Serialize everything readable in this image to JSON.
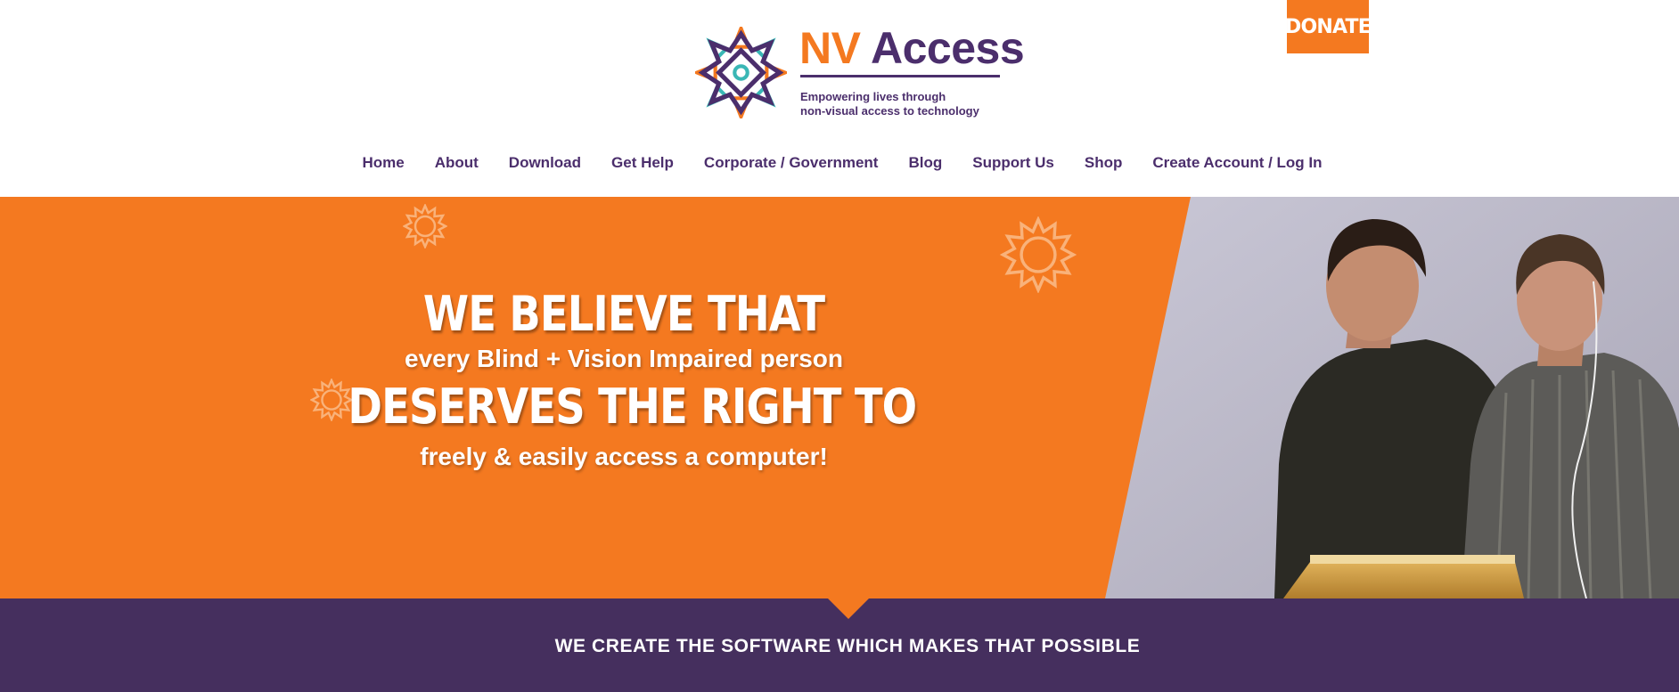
{
  "brand": {
    "name_part1": "NV",
    "name_part2": "Access",
    "tagline_line1": "Empowering lives through",
    "tagline_line2": "non-visual access to technology",
    "orange": "#f47920",
    "purple": "#4b2e6c",
    "teal": "#3ab7b5",
    "logo_icon": "sunburst-logo-icon"
  },
  "header": {
    "donate_label": "DONATE"
  },
  "nav": {
    "items": [
      {
        "label": "Home"
      },
      {
        "label": "About"
      },
      {
        "label": "Download"
      },
      {
        "label": "Get Help"
      },
      {
        "label": "Corporate / Government"
      },
      {
        "label": "Blog"
      },
      {
        "label": "Support Us"
      },
      {
        "label": "Shop"
      },
      {
        "label": "Create Account / Log In"
      }
    ]
  },
  "hero": {
    "line1": "WE BELIEVE THAT",
    "line2": "every Blind + Vision Impaired person",
    "line3": "DESERVES THE RIGHT TO",
    "line4": "freely & easily access a computer!",
    "background": "#f47920",
    "photo_icon": "presenters-photo",
    "decor_icon": "sunburst-outline-icon"
  },
  "band": {
    "title": "WE CREATE THE SOFTWARE WHICH MAKES THAT POSSIBLE",
    "background": "#452f5e"
  }
}
